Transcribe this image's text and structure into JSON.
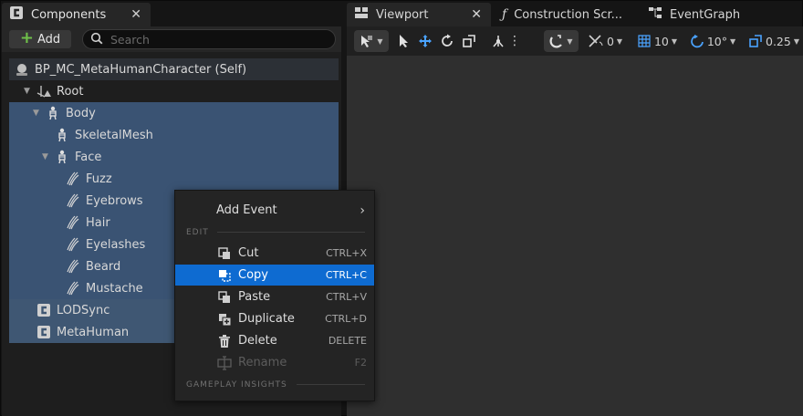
{
  "components_panel": {
    "tab_title": "Components",
    "add_label": "Add",
    "search_placeholder": "Search",
    "tree": {
      "self": "BP_MC_MetaHumanCharacter (Self)",
      "root": "Root",
      "body": "Body",
      "skeletal_mesh": "SkeletalMesh",
      "face": "Face",
      "grooms": [
        "Fuzz",
        "Eyebrows",
        "Hair",
        "Eyelashes",
        "Beard",
        "Mustache"
      ],
      "lodsync": "LODSync",
      "metahuman": "MetaHuman"
    }
  },
  "editor_tabs": [
    "Viewport",
    "Construction Scr...",
    "EventGraph"
  ],
  "viewport_toolbar": {
    "rotation_snap": "0",
    "grid_snap": "10",
    "angle_snap": "10°",
    "scale_snap": "0.25"
  },
  "context_menu": {
    "add_event": "Add Event",
    "section_edit": "EDIT",
    "section_gameplay": "GAMEPLAY INSIGHTS",
    "items": [
      {
        "label": "Cut",
        "shortcut": "CTRL+X"
      },
      {
        "label": "Copy",
        "shortcut": "CTRL+C"
      },
      {
        "label": "Paste",
        "shortcut": "CTRL+V"
      },
      {
        "label": "Duplicate",
        "shortcut": "CTRL+D"
      },
      {
        "label": "Delete",
        "shortcut": "DELETE"
      },
      {
        "label": "Rename",
        "shortcut": "F2"
      }
    ]
  },
  "colors": {
    "highlight": "#0e6bd1",
    "selection": "#3a5373",
    "add_plus": "#6fc04a",
    "accent_icon": "#4aa3ff"
  }
}
